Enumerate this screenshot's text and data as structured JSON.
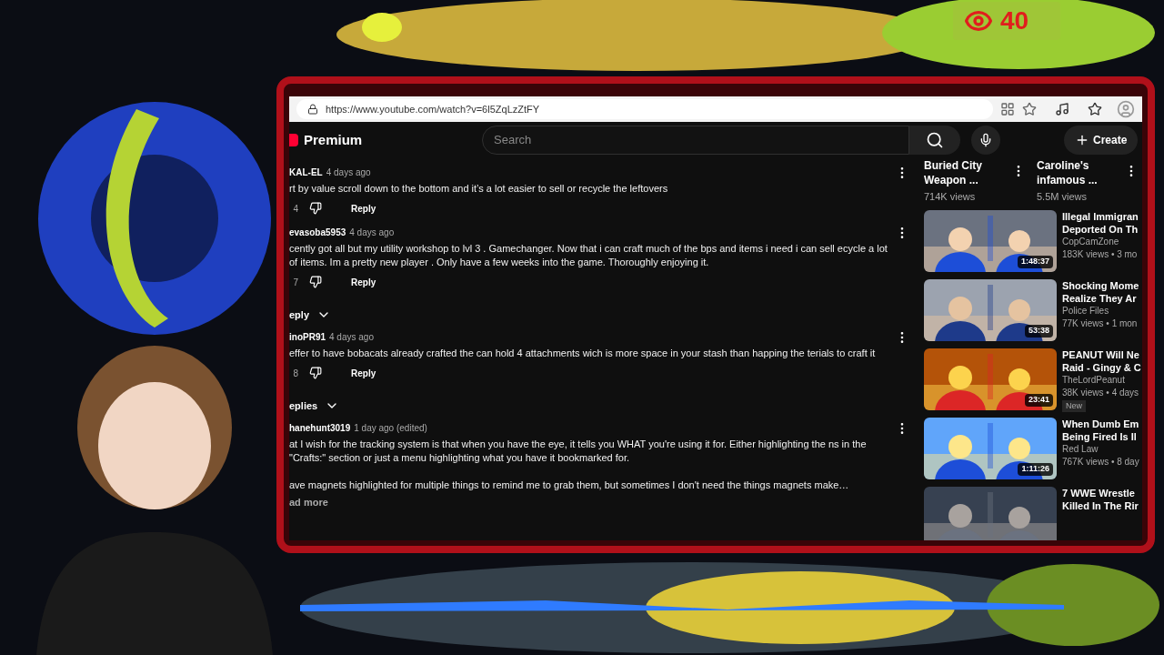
{
  "viewer_count": "40",
  "browser": {
    "url": "https://www.youtube.com/watch?v=6l5ZqLzZtFY"
  },
  "youtube": {
    "logo": "Premium",
    "search": {
      "placeholder": "Search"
    },
    "create": "Create"
  },
  "comments": [
    {
      "kind": "comment",
      "author": "KAL-EL",
      "time": "4 days ago",
      "paragraphs": [
        "rt by value scroll down to the bottom and it’s a lot easier to sell or recycle the leftovers"
      ],
      "likes": "4",
      "reply": "Reply"
    },
    {
      "kind": "comment",
      "author": "evasoba5953",
      "time": "4 days ago",
      "paragraphs": [
        "cently got all but my utility workshop to lvl 3 . Gamechanger. Now that i can craft much of the bps and items i need i can sell ecycle a lot of items. Im a pretty new player . Only have a few weeks into the game. Thoroughly enjoying it."
      ],
      "likes": "7",
      "reply": "Reply"
    },
    {
      "kind": "toggle",
      "label": "eply"
    },
    {
      "kind": "comment",
      "author": "inoPR91",
      "time": "4 days ago",
      "paragraphs": [
        "effer to have bobacats already crafted the can hold 4 attachments wich is more space in your stash than happing the terials to craft it"
      ],
      "likes": "8",
      "reply": "Reply"
    },
    {
      "kind": "toggle",
      "label": "eplies"
    },
    {
      "kind": "comment",
      "author": "hanehunt3019",
      "time": "1 day ago (edited)",
      "paragraphs": [
        "at I wish for the tracking system is that when you have the eye, it tells you WHAT you're using it for. Either highlighting the ns in the \"Crafts:\" section or just a menu highlighting what you have it bookmarked for.",
        "ave magnets highlighted for multiple things to remind me to grab them, but sometimes I don't need the things magnets make…"
      ],
      "more": "ad more"
    }
  ],
  "top_videos": [
    {
      "title": [
        "Buried City",
        "Weapon ..."
      ],
      "views": "714K views"
    },
    {
      "title": [
        "Caroline's",
        "infamous ..."
      ],
      "views": "5.5M views"
    }
  ],
  "videos": [
    {
      "title": [
        "Illegal Immigran",
        "Deported On Th"
      ],
      "channel": "CopCamZone",
      "meta": "183K views • 3 mo",
      "duration": "1:48:37"
    },
    {
      "title": [
        "Shocking Mome",
        "Realize They Ar"
      ],
      "channel": "Police Files",
      "meta": "77K views • 1 mon",
      "duration": "53:38"
    },
    {
      "title": [
        "PEANUT Will Ne",
        "Raid - Gingy & C"
      ],
      "channel": "TheLordPeanut",
      "meta": "38K views • 4 days",
      "duration": "23:41",
      "badge": "New"
    },
    {
      "title": [
        "When Dumb Em",
        "Being Fired Is Il"
      ],
      "channel": "Red Law",
      "meta": "767K views • 8 day",
      "duration": "1:11:26"
    },
    {
      "title": [
        "7 WWE Wrestle",
        "Killed In The Rir"
      ]
    }
  ]
}
